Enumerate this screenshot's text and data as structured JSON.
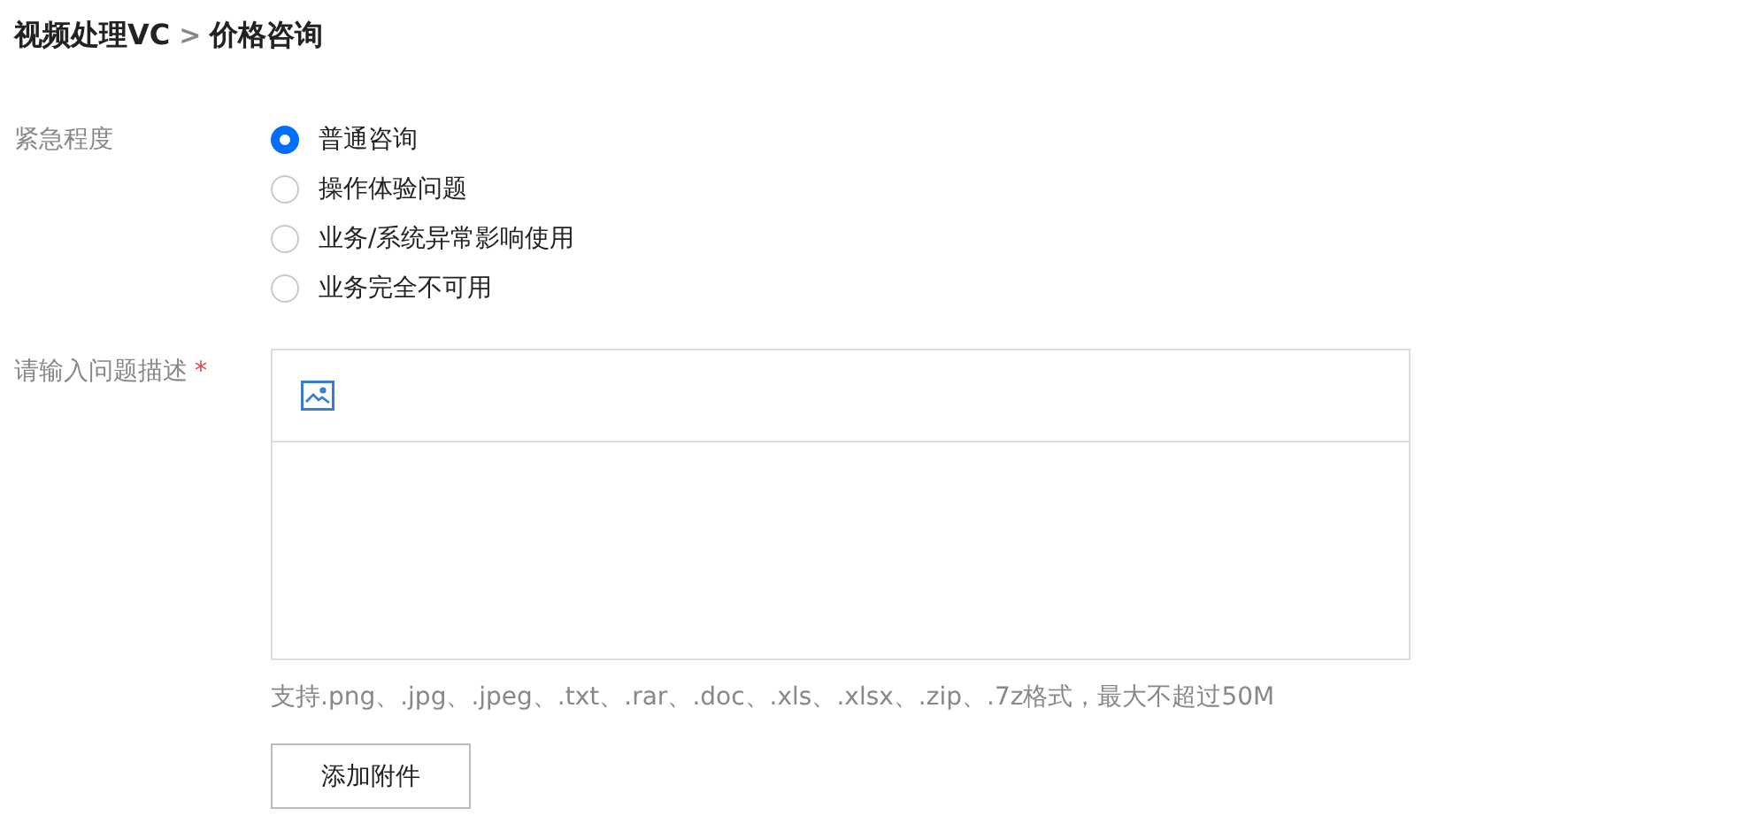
{
  "breadcrumb": {
    "parent": "视频处理VC",
    "separator": ">",
    "current": "价格咨询"
  },
  "urgency": {
    "label": "紧急程度",
    "options": [
      {
        "label": "普通咨询",
        "selected": true
      },
      {
        "label": "操作体验问题",
        "selected": false
      },
      {
        "label": "业务/系统异常影响使用",
        "selected": false
      },
      {
        "label": "业务完全不可用",
        "selected": false
      }
    ]
  },
  "description": {
    "label": "请输入问题描述",
    "required_mark": "*"
  },
  "attachment_hint": "支持.png、.jpg、.jpeg、.txt、.rar、.doc、.xls、.xlsx、.zip、.7z格式，最大不超过50M",
  "attach_button": "添加附件"
}
